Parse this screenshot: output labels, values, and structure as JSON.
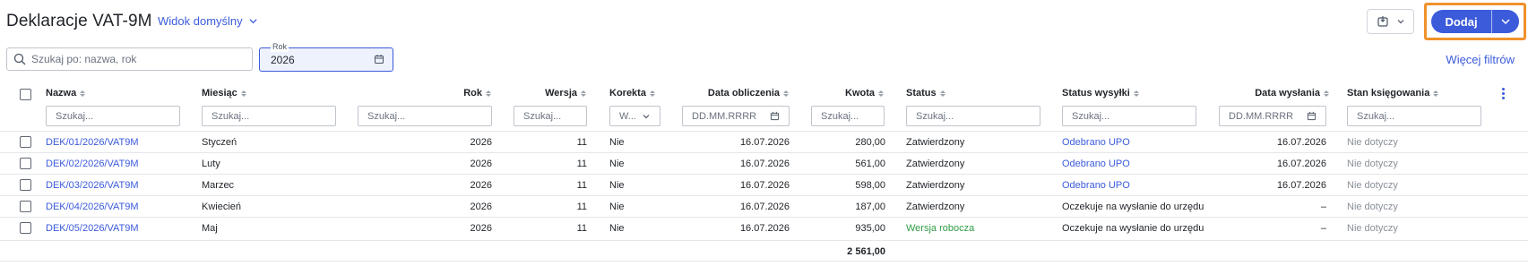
{
  "header": {
    "title": "Deklaracje VAT-9M",
    "view_label": "Widok domyślny",
    "add_label": "Dodaj"
  },
  "filters": {
    "search_placeholder": "Szukaj po: nazwa, rok",
    "year_legend": "Rok",
    "year_value": "2026",
    "more_filters": "Więcej filtrów"
  },
  "table": {
    "columns": {
      "name": "Nazwa",
      "month": "Miesiąc",
      "year": "Rok",
      "version": "Wersja",
      "correction": "Korekta",
      "calc_date": "Data obliczenia",
      "amount": "Kwota",
      "status": "Status",
      "send_status": "Status wysyłki",
      "send_date": "Data wysłania",
      "booking": "Stan księgowania"
    },
    "filter_placeholders": {
      "text": "Szukaj...",
      "select": "W...",
      "date": "DD.MM.RRRR"
    },
    "rows": [
      {
        "name": "DEK/01/2026/VAT9M",
        "month": "Styczeń",
        "year": "2026",
        "version": "11",
        "correction": "Nie",
        "calc_date": "16.07.2026",
        "amount": "280,00",
        "status": "Zatwierdzony",
        "send_status": "Odebrano UPO",
        "send_date": "16.07.2026",
        "booking": "Nie dotyczy"
      },
      {
        "name": "DEK/02/2026/VAT9M",
        "month": "Luty",
        "year": "2026",
        "version": "11",
        "correction": "Nie",
        "calc_date": "16.07.2026",
        "amount": "561,00",
        "status": "Zatwierdzony",
        "send_status": "Odebrano UPO",
        "send_date": "16.07.2026",
        "booking": "Nie dotyczy"
      },
      {
        "name": "DEK/03/2026/VAT9M",
        "month": "Marzec",
        "year": "2026",
        "version": "11",
        "correction": "Nie",
        "calc_date": "16.07.2026",
        "amount": "598,00",
        "status": "Zatwierdzony",
        "send_status": "Odebrano UPO",
        "send_date": "16.07.2026",
        "booking": "Nie dotyczy"
      },
      {
        "name": "DEK/04/2026/VAT9M",
        "month": "Kwiecień",
        "year": "2026",
        "version": "11",
        "correction": "Nie",
        "calc_date": "16.07.2026",
        "amount": "187,00",
        "status": "Zatwierdzony",
        "send_status": "Oczekuje na wysłanie do urzędu",
        "send_date": "–",
        "booking": "Nie dotyczy"
      },
      {
        "name": "DEK/05/2026/VAT9M",
        "month": "Maj",
        "year": "2026",
        "version": "11",
        "correction": "Nie",
        "calc_date": "16.07.2026",
        "amount": "935,00",
        "status": "Wersja robocza",
        "send_status": "Oczekuje na wysłanie do urzędu",
        "send_date": "–",
        "booking": "Nie dotyczy"
      }
    ],
    "total_amount": "2 561,00"
  },
  "colors": {
    "accent": "#3b5bdb",
    "highlight": "#f0912b",
    "draft_status": "#2f9e44"
  }
}
